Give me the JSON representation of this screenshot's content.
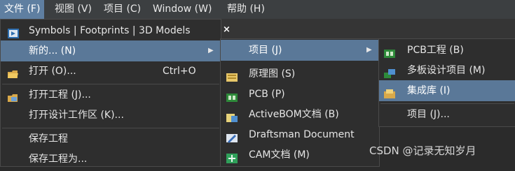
{
  "menubar": {
    "items": [
      "文件 (F)",
      "视图 (V)",
      "项目 (C)",
      "Window (W)",
      "帮助 (H)"
    ]
  },
  "file_menu": {
    "items": [
      {
        "label": "Symbols | Footprints | 3D Models",
        "icon": "components-panel-icon"
      },
      {
        "label": "新的... (N)",
        "icon": "",
        "submenu": true
      },
      {
        "label": "打开 (O)...",
        "icon": "folder-open-icon",
        "shortcut": "Ctrl+O"
      },
      {
        "label": "打开工程 (J)...",
        "icon": "open-project-icon"
      },
      {
        "label": "打开设计工作区 (K)...",
        "icon": ""
      },
      {
        "label": "保存工程",
        "icon": ""
      },
      {
        "label": "保存工程为...",
        "icon": ""
      }
    ]
  },
  "new_menu": {
    "items": [
      {
        "label": "项目 (J)",
        "submenu": true,
        "icon": ""
      },
      {
        "label": "原理图 (S)",
        "icon": "schematic-icon"
      },
      {
        "label": "PCB (P)",
        "icon": "pcb-icon"
      },
      {
        "label": "ActiveBOM文档 (B)",
        "icon": "activebom-icon"
      },
      {
        "label": "Draftsman Document",
        "icon": "draftsman-icon"
      },
      {
        "label": "CAM文档 (M)",
        "icon": "cam-icon"
      }
    ]
  },
  "project_menu": {
    "items": [
      {
        "label": "PCB工程 (B)",
        "icon": "pcb-project-icon"
      },
      {
        "label": "多板设计项目 (M)",
        "icon": "multiboard-project-icon"
      },
      {
        "label": "集成库 (I)",
        "icon": "integrated-library-icon"
      },
      {
        "label": "项目 (J)...",
        "icon": ""
      }
    ]
  },
  "watermark": "CSDN @记录无知岁月",
  "colors": {
    "highlight": "#5a7898",
    "menubar": "#3c3f41",
    "menu_bg": "#2e2e2e"
  }
}
